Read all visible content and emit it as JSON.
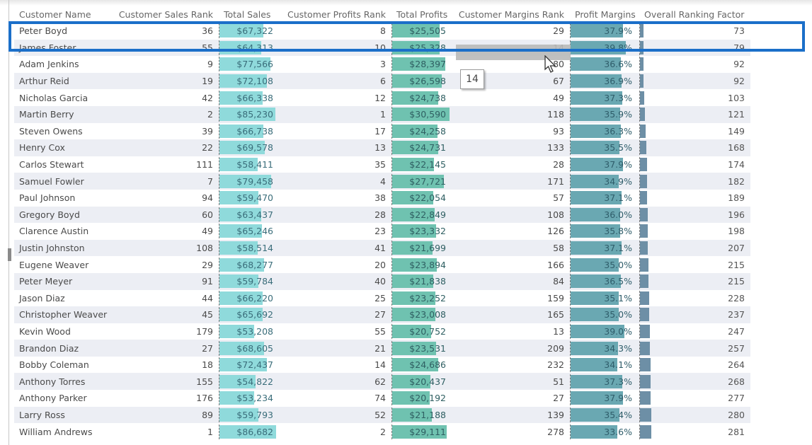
{
  "columns": [
    {
      "key": "name",
      "label": "Customer Name"
    },
    {
      "key": "sales_rank",
      "label": "Customer Sales Rank"
    },
    {
      "key": "total_sales",
      "label": "Total Sales"
    },
    {
      "key": "profits_rank",
      "label": "Customer Profits Rank"
    },
    {
      "key": "total_profits",
      "label": "Total Profits"
    },
    {
      "key": "margins_rank",
      "label": "Customer Margins Rank"
    },
    {
      "key": "profit_margins",
      "label": "Profit Margins"
    },
    {
      "key": "overall",
      "label": "Overall Ranking Factor"
    }
  ],
  "rows": [
    {
      "name": "Peter Boyd",
      "sales_rank": "36",
      "total_sales": "$67,322",
      "profits_rank": "8",
      "total_profits": "$25,505",
      "margins_rank": "29",
      "profit_margins": "37.9%",
      "overall": "73"
    },
    {
      "name": "James Foster",
      "sales_rank": "55",
      "total_sales": "$64,313",
      "profits_rank": "10",
      "total_profits": "$25,328",
      "margins_rank": "14",
      "profit_margins": "39.8%",
      "overall": "79"
    },
    {
      "name": "Adam Jenkins",
      "sales_rank": "9",
      "total_sales": "$77,566",
      "profits_rank": "3",
      "total_profits": "$28,397",
      "margins_rank": "80",
      "profit_margins": "36.6%",
      "overall": "92"
    },
    {
      "name": "Arthur Reid",
      "sales_rank": "19",
      "total_sales": "$72,108",
      "profits_rank": "6",
      "total_profits": "$26,598",
      "margins_rank": "67",
      "profit_margins": "36.9%",
      "overall": "92"
    },
    {
      "name": "Nicholas Garcia",
      "sales_rank": "42",
      "total_sales": "$66,338",
      "profits_rank": "12",
      "total_profits": "$24,738",
      "margins_rank": "49",
      "profit_margins": "37.3%",
      "overall": "103"
    },
    {
      "name": "Martin Berry",
      "sales_rank": "2",
      "total_sales": "$85,230",
      "profits_rank": "1",
      "total_profits": "$30,590",
      "margins_rank": "118",
      "profit_margins": "35.9%",
      "overall": "121"
    },
    {
      "name": "Steven Owens",
      "sales_rank": "39",
      "total_sales": "$66,738",
      "profits_rank": "17",
      "total_profits": "$24,258",
      "margins_rank": "93",
      "profit_margins": "36.3%",
      "overall": "149"
    },
    {
      "name": "Henry Cox",
      "sales_rank": "22",
      "total_sales": "$69,578",
      "profits_rank": "13",
      "total_profits": "$24,731",
      "margins_rank": "133",
      "profit_margins": "35.5%",
      "overall": "168"
    },
    {
      "name": "Carlos Stewart",
      "sales_rank": "111",
      "total_sales": "$58,411",
      "profits_rank": "35",
      "total_profits": "$22,145",
      "margins_rank": "28",
      "profit_margins": "37.9%",
      "overall": "174"
    },
    {
      "name": "Samuel Fowler",
      "sales_rank": "7",
      "total_sales": "$79,458",
      "profits_rank": "4",
      "total_profits": "$27,721",
      "margins_rank": "171",
      "profit_margins": "34.9%",
      "overall": "182"
    },
    {
      "name": "Paul Johnson",
      "sales_rank": "94",
      "total_sales": "$59,470",
      "profits_rank": "38",
      "total_profits": "$22,054",
      "margins_rank": "57",
      "profit_margins": "37.1%",
      "overall": "189"
    },
    {
      "name": "Gregory Boyd",
      "sales_rank": "60",
      "total_sales": "$63,437",
      "profits_rank": "28",
      "total_profits": "$22,849",
      "margins_rank": "108",
      "profit_margins": "36.0%",
      "overall": "196"
    },
    {
      "name": "Clarence Austin",
      "sales_rank": "49",
      "total_sales": "$65,246",
      "profits_rank": "23",
      "total_profits": "$23,332",
      "margins_rank": "126",
      "profit_margins": "35.8%",
      "overall": "198"
    },
    {
      "name": "Justin Johnston",
      "sales_rank": "108",
      "total_sales": "$58,514",
      "profits_rank": "41",
      "total_profits": "$21,699",
      "margins_rank": "58",
      "profit_margins": "37.1%",
      "overall": "207"
    },
    {
      "name": "Eugene Weaver",
      "sales_rank": "29",
      "total_sales": "$68,277",
      "profits_rank": "20",
      "total_profits": "$23,894",
      "margins_rank": "166",
      "profit_margins": "35.0%",
      "overall": "215"
    },
    {
      "name": "Peter Meyer",
      "sales_rank": "91",
      "total_sales": "$59,784",
      "profits_rank": "40",
      "total_profits": "$21,838",
      "margins_rank": "84",
      "profit_margins": "36.5%",
      "overall": "215"
    },
    {
      "name": "Jason Diaz",
      "sales_rank": "44",
      "total_sales": "$66,220",
      "profits_rank": "25",
      "total_profits": "$23,252",
      "margins_rank": "159",
      "profit_margins": "35.1%",
      "overall": "228"
    },
    {
      "name": "Christopher Weaver",
      "sales_rank": "45",
      "total_sales": "$65,692",
      "profits_rank": "27",
      "total_profits": "$23,008",
      "margins_rank": "165",
      "profit_margins": "35.0%",
      "overall": "237"
    },
    {
      "name": "Kevin Wood",
      "sales_rank": "179",
      "total_sales": "$53,208",
      "profits_rank": "55",
      "total_profits": "$20,752",
      "margins_rank": "13",
      "profit_margins": "39.0%",
      "overall": "247"
    },
    {
      "name": "Brandon Diaz",
      "sales_rank": "27",
      "total_sales": "$68,605",
      "profits_rank": "21",
      "total_profits": "$23,531",
      "margins_rank": "209",
      "profit_margins": "34.3%",
      "overall": "257"
    },
    {
      "name": "Bobby Coleman",
      "sales_rank": "18",
      "total_sales": "$72,437",
      "profits_rank": "14",
      "total_profits": "$24,686",
      "margins_rank": "232",
      "profit_margins": "34.1%",
      "overall": "264"
    },
    {
      "name": "Anthony Torres",
      "sales_rank": "155",
      "total_sales": "$54,822",
      "profits_rank": "62",
      "total_profits": "$20,437",
      "margins_rank": "51",
      "profit_margins": "37.3%",
      "overall": "268"
    },
    {
      "name": "Anthony Parker",
      "sales_rank": "176",
      "total_sales": "$53,234",
      "profits_rank": "74",
      "total_profits": "$20,192",
      "margins_rank": "27",
      "profit_margins": "37.9%",
      "overall": "277"
    },
    {
      "name": "Larry Ross",
      "sales_rank": "89",
      "total_sales": "$59,793",
      "profits_rank": "52",
      "total_profits": "$21,188",
      "margins_rank": "139",
      "profit_margins": "35.4%",
      "overall": "280"
    },
    {
      "name": "William Andrews",
      "sales_rank": "1",
      "total_sales": "$86,682",
      "profits_rank": "2",
      "total_profits": "$29,111",
      "margins_rank": "278",
      "profit_margins": "33.6%",
      "overall": "281"
    }
  ],
  "tooltip": {
    "value": "14"
  },
  "highlighted_row": "Peter Boyd",
  "colors": {
    "highlight_border": "#1b6fc9",
    "sales_bar": "#8fdadb",
    "profit_bar": "#6fc2b0",
    "margin_bar": "#6aa8b2",
    "overall_bar": "#6d8fa6",
    "row_alt": "#eceef4"
  }
}
